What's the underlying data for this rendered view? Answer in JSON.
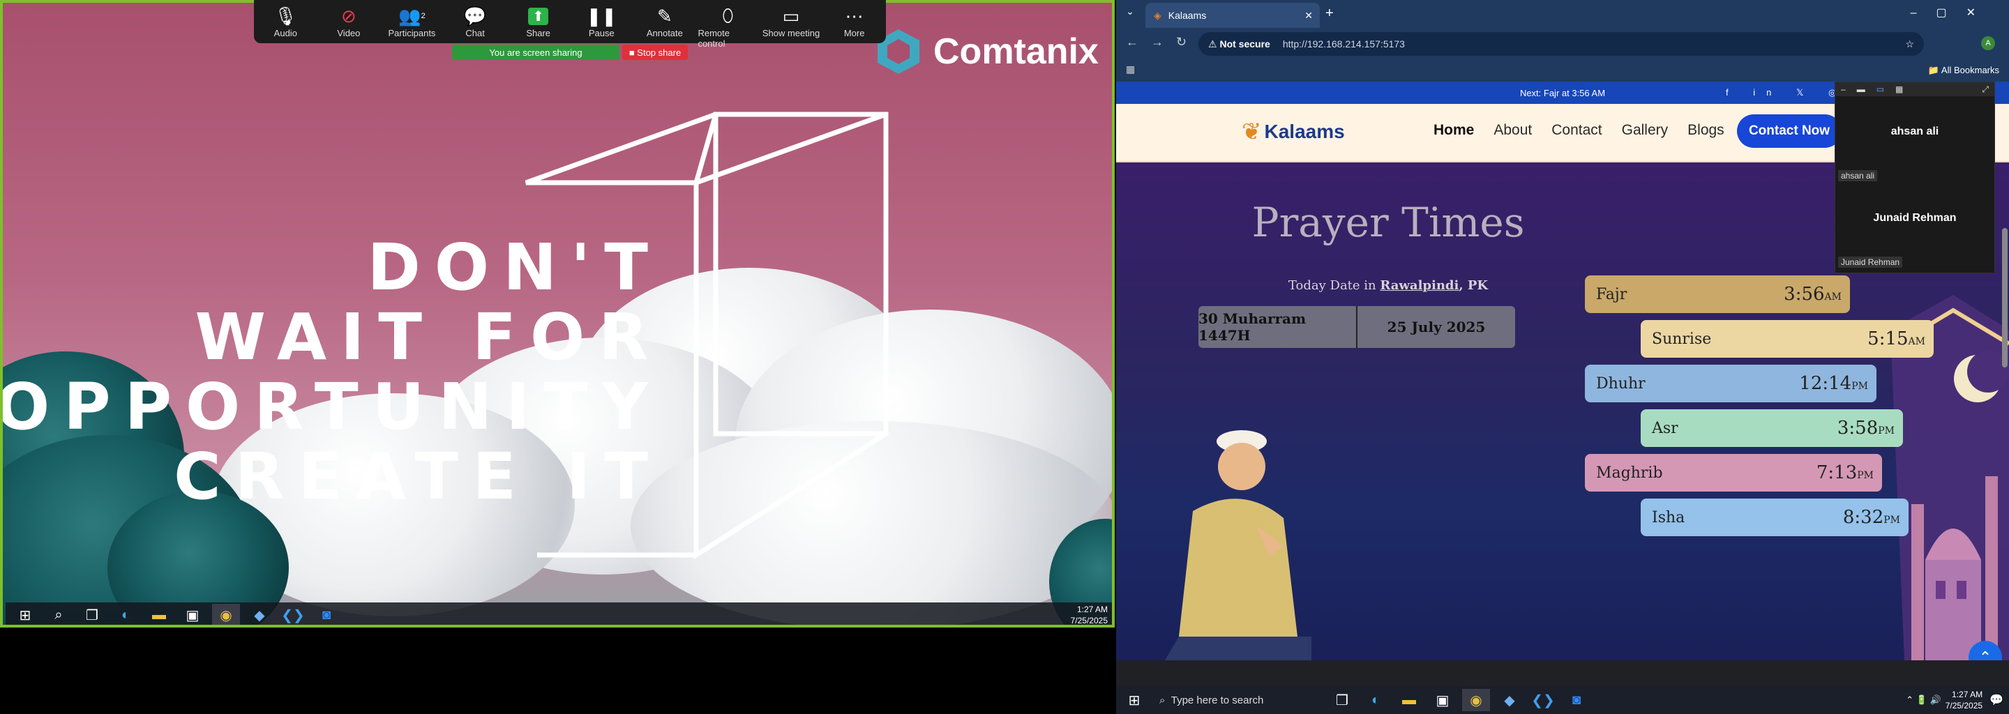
{
  "zoom": {
    "toolbar": [
      {
        "label": "Audio",
        "icon": "microphone-icon"
      },
      {
        "label": "Video",
        "icon": "video-off-icon"
      },
      {
        "label": "Participants",
        "icon": "participants-icon",
        "count": "2"
      },
      {
        "label": "Chat",
        "icon": "chat-icon"
      },
      {
        "label": "Share",
        "icon": "share-icon"
      },
      {
        "label": "Pause",
        "icon": "pause-icon"
      },
      {
        "label": "Annotate",
        "icon": "annotate-icon"
      },
      {
        "label": "Remote control",
        "icon": "remote-control-icon"
      },
      {
        "label": "Show meeting",
        "icon": "show-meeting-icon"
      },
      {
        "label": "More",
        "icon": "more-icon"
      }
    ],
    "sharing_text": "You are screen sharing",
    "stop_share": "Stop share",
    "accent": "#7ec02a"
  },
  "wallpaper": {
    "brand": "Comtanix",
    "quote_lines": [
      "DON'T",
      "WAIT FOR",
      "OPPORTUNITY",
      "CREATE IT"
    ]
  },
  "left_taskbar": {
    "time": "1:27 AM",
    "date": "7/25/2025"
  },
  "browser": {
    "tab_title": "Kalaams",
    "security": "Not secure",
    "url": "http://192.168.214.157:5173",
    "bookmarks": "All Bookmarks",
    "profile": "A"
  },
  "site": {
    "next_prayer": "Next: Fajr at 3:56 AM",
    "logo": "Kalaams",
    "nav": [
      "Home",
      "About",
      "Contact",
      "Gallery",
      "Blogs"
    ],
    "cta": "Contact Now",
    "title": "Prayer Times",
    "today_prefix": "Today Date in",
    "city": "Rawalpindi",
    "country": ", PK",
    "hijri_date": "30 Muharram 1447H",
    "greg_date": "25 July 2025",
    "prayers": [
      {
        "name": "Fajr",
        "time": "3:56",
        "ampm": "AM",
        "color": "#c9a86a"
      },
      {
        "name": "Sunrise",
        "time": "5:15",
        "ampm": "AM",
        "color": "#ecd6a2"
      },
      {
        "name": "Dhuhr",
        "time": "12:14",
        "ampm": "PM",
        "color": "#8fb6de"
      },
      {
        "name": "Asr",
        "time": "3:58",
        "ampm": "PM",
        "color": "#a8dcc0"
      },
      {
        "name": "Maghrib",
        "time": "7:13",
        "ampm": "PM",
        "color": "#d498b4"
      },
      {
        "name": "Isha",
        "time": "8:32",
        "ampm": "PM",
        "color": "#94c2ea"
      }
    ]
  },
  "participants_panel": {
    "people": [
      {
        "name": "ahsan ali",
        "tag": "ahsan ali"
      },
      {
        "name": "Junaid Rehman",
        "tag": "Junaid Rehman"
      }
    ]
  },
  "right_taskbar": {
    "search_placeholder": "Type here to search",
    "time": "1:27 AM",
    "date": "7/25/2025"
  }
}
